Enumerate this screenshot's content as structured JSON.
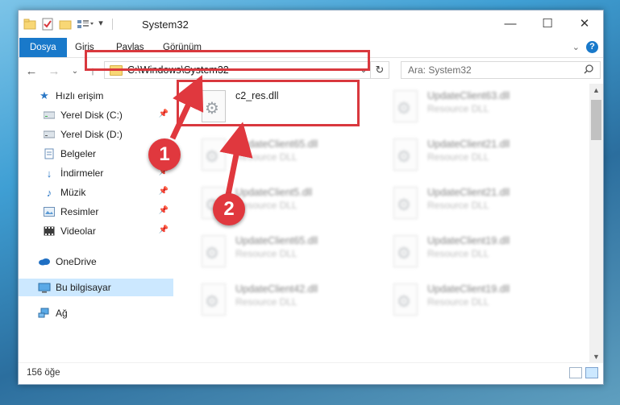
{
  "window": {
    "title": "System32"
  },
  "ribbon": {
    "tabs": [
      "Dosya",
      "Giriş",
      "Paylaş",
      "Görünüm"
    ],
    "help": "?"
  },
  "nav": {
    "address": "C:\\Windows\\System32",
    "search_placeholder": "Ara: System32"
  },
  "sidebar": {
    "items": [
      {
        "label": "Hızlı erişim",
        "icon": "star-icon",
        "pinned": false
      },
      {
        "label": "Yerel Disk (C:)",
        "icon": "drive-icon",
        "pinned": true
      },
      {
        "label": "Yerel Disk (D:)",
        "icon": "drive-icon",
        "pinned": false
      },
      {
        "label": "Belgeler",
        "icon": "documents-icon",
        "pinned": true
      },
      {
        "label": "İndirmeler",
        "icon": "download-icon",
        "pinned": true
      },
      {
        "label": "Müzik",
        "icon": "music-icon",
        "pinned": true
      },
      {
        "label": "Resimler",
        "icon": "pictures-icon",
        "pinned": true
      },
      {
        "label": "Videolar",
        "icon": "video-icon",
        "pinned": true
      },
      {
        "label": "OneDrive",
        "icon": "cloud-icon",
        "pinned": false
      },
      {
        "label": "Bu bilgisayar",
        "icon": "computer-icon",
        "pinned": false,
        "selected": true
      },
      {
        "label": "Ağ",
        "icon": "network-icon",
        "pinned": false
      }
    ]
  },
  "files": [
    {
      "name": "c2_res.dll",
      "type": "",
      "blurred": false
    },
    {
      "name": "UpdateClient63.dll",
      "type": "Resource DLL",
      "blurred": true
    },
    {
      "name": "UpdateClient65.dll",
      "type": "Resource DLL",
      "blurred": true
    },
    {
      "name": "UpdateClient21.dll",
      "type": "Resource DLL",
      "blurred": true
    },
    {
      "name": "UpdateClient5.dll",
      "type": "Resource DLL",
      "blurred": true
    },
    {
      "name": "UpdateClient21.dll",
      "type": "Resource DLL",
      "blurred": true
    },
    {
      "name": "UpdateClient65.dll",
      "type": "Resource DLL",
      "blurred": true
    },
    {
      "name": "UpdateClient19.dll",
      "type": "Resource DLL",
      "blurred": true
    },
    {
      "name": "UpdateClient42.dll",
      "type": "Resource DLL",
      "blurred": true
    },
    {
      "name": "UpdateClient19.dll",
      "type": "Resource DLL",
      "blurred": true
    }
  ],
  "status": {
    "count_text": "156 öğe"
  },
  "callouts": [
    "1",
    "2"
  ],
  "colors": {
    "accent": "#1979ca",
    "highlight": "#d9383e",
    "selection": "#cce8ff"
  }
}
